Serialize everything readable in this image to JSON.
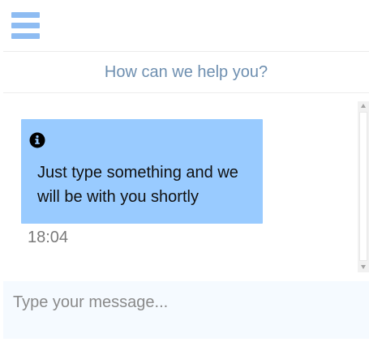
{
  "header": {
    "menu_icon": "hamburger-menu-icon",
    "accent_color": "#8ebcf2"
  },
  "subheader": {
    "title": "How can we help you?"
  },
  "chat": {
    "messages": [
      {
        "icon": "info-icon",
        "text": "Just type something and we will be with you shortly",
        "time": "18:04",
        "bubble_color": "#99cbff"
      }
    ]
  },
  "composer": {
    "value": "",
    "placeholder": "Type your message..."
  }
}
